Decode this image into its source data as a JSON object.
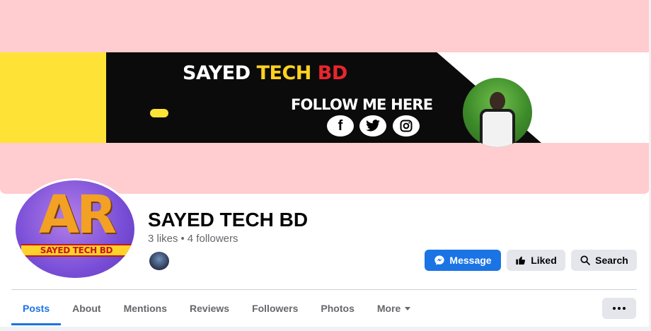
{
  "cover": {
    "banner_title_part1": "SAYED",
    "banner_title_part2": "TECH",
    "banner_title_part3": "BD",
    "banner_subtitle": "FOLLOW ME HERE",
    "social_icons": [
      "facebook-icon",
      "twitter-icon",
      "instagram-icon"
    ],
    "colors": {
      "background": "#ffcccf",
      "yellow": "#ffe236",
      "black": "#0b0b0b"
    }
  },
  "avatar": {
    "monogram": "AR",
    "caption": "SAYED TECH BD"
  },
  "page": {
    "name": "SAYED TECH BD",
    "likes": "3 likes",
    "separator": "•",
    "followers": "4 followers"
  },
  "actions": {
    "message_label": "Message",
    "liked_label": "Liked",
    "search_label": "Search"
  },
  "tabs": [
    {
      "label": "Posts",
      "active": true
    },
    {
      "label": "About"
    },
    {
      "label": "Mentions"
    },
    {
      "label": "Reviews"
    },
    {
      "label": "Followers"
    },
    {
      "label": "Photos"
    },
    {
      "label": "More",
      "has_caret": true
    }
  ],
  "accent_color": "#1b74e4"
}
